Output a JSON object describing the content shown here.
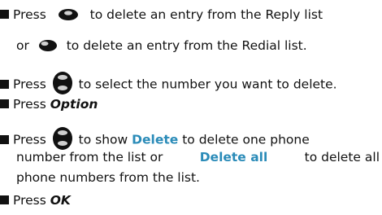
{
  "instructions": {
    "l1": {
      "a": "Press",
      "b": "to delete an entry from the Reply list"
    },
    "l2": {
      "a": "or",
      "b": "to delete an entry from the Redial list."
    },
    "l3": {
      "a": "Press",
      "b": "to select the number you want to delete."
    },
    "l4": {
      "a": "Press",
      "b": "Option"
    },
    "l5": {
      "a": "Press",
      "b": "to show",
      "c": "Delete",
      "d": "to delete one phone"
    },
    "l6": {
      "a": "number from the list or",
      "b": "Delete all",
      "c": "to delete all"
    },
    "l7": {
      "a": "phone numbers from the list."
    },
    "l8": {
      "a": "Press",
      "b": "OK"
    }
  },
  "colors": {
    "keyword": "#2a8bb8",
    "text": "#111111"
  },
  "icons": [
    "left-softkey-icon",
    "right-softkey-icon",
    "navigation-key-icon"
  ]
}
